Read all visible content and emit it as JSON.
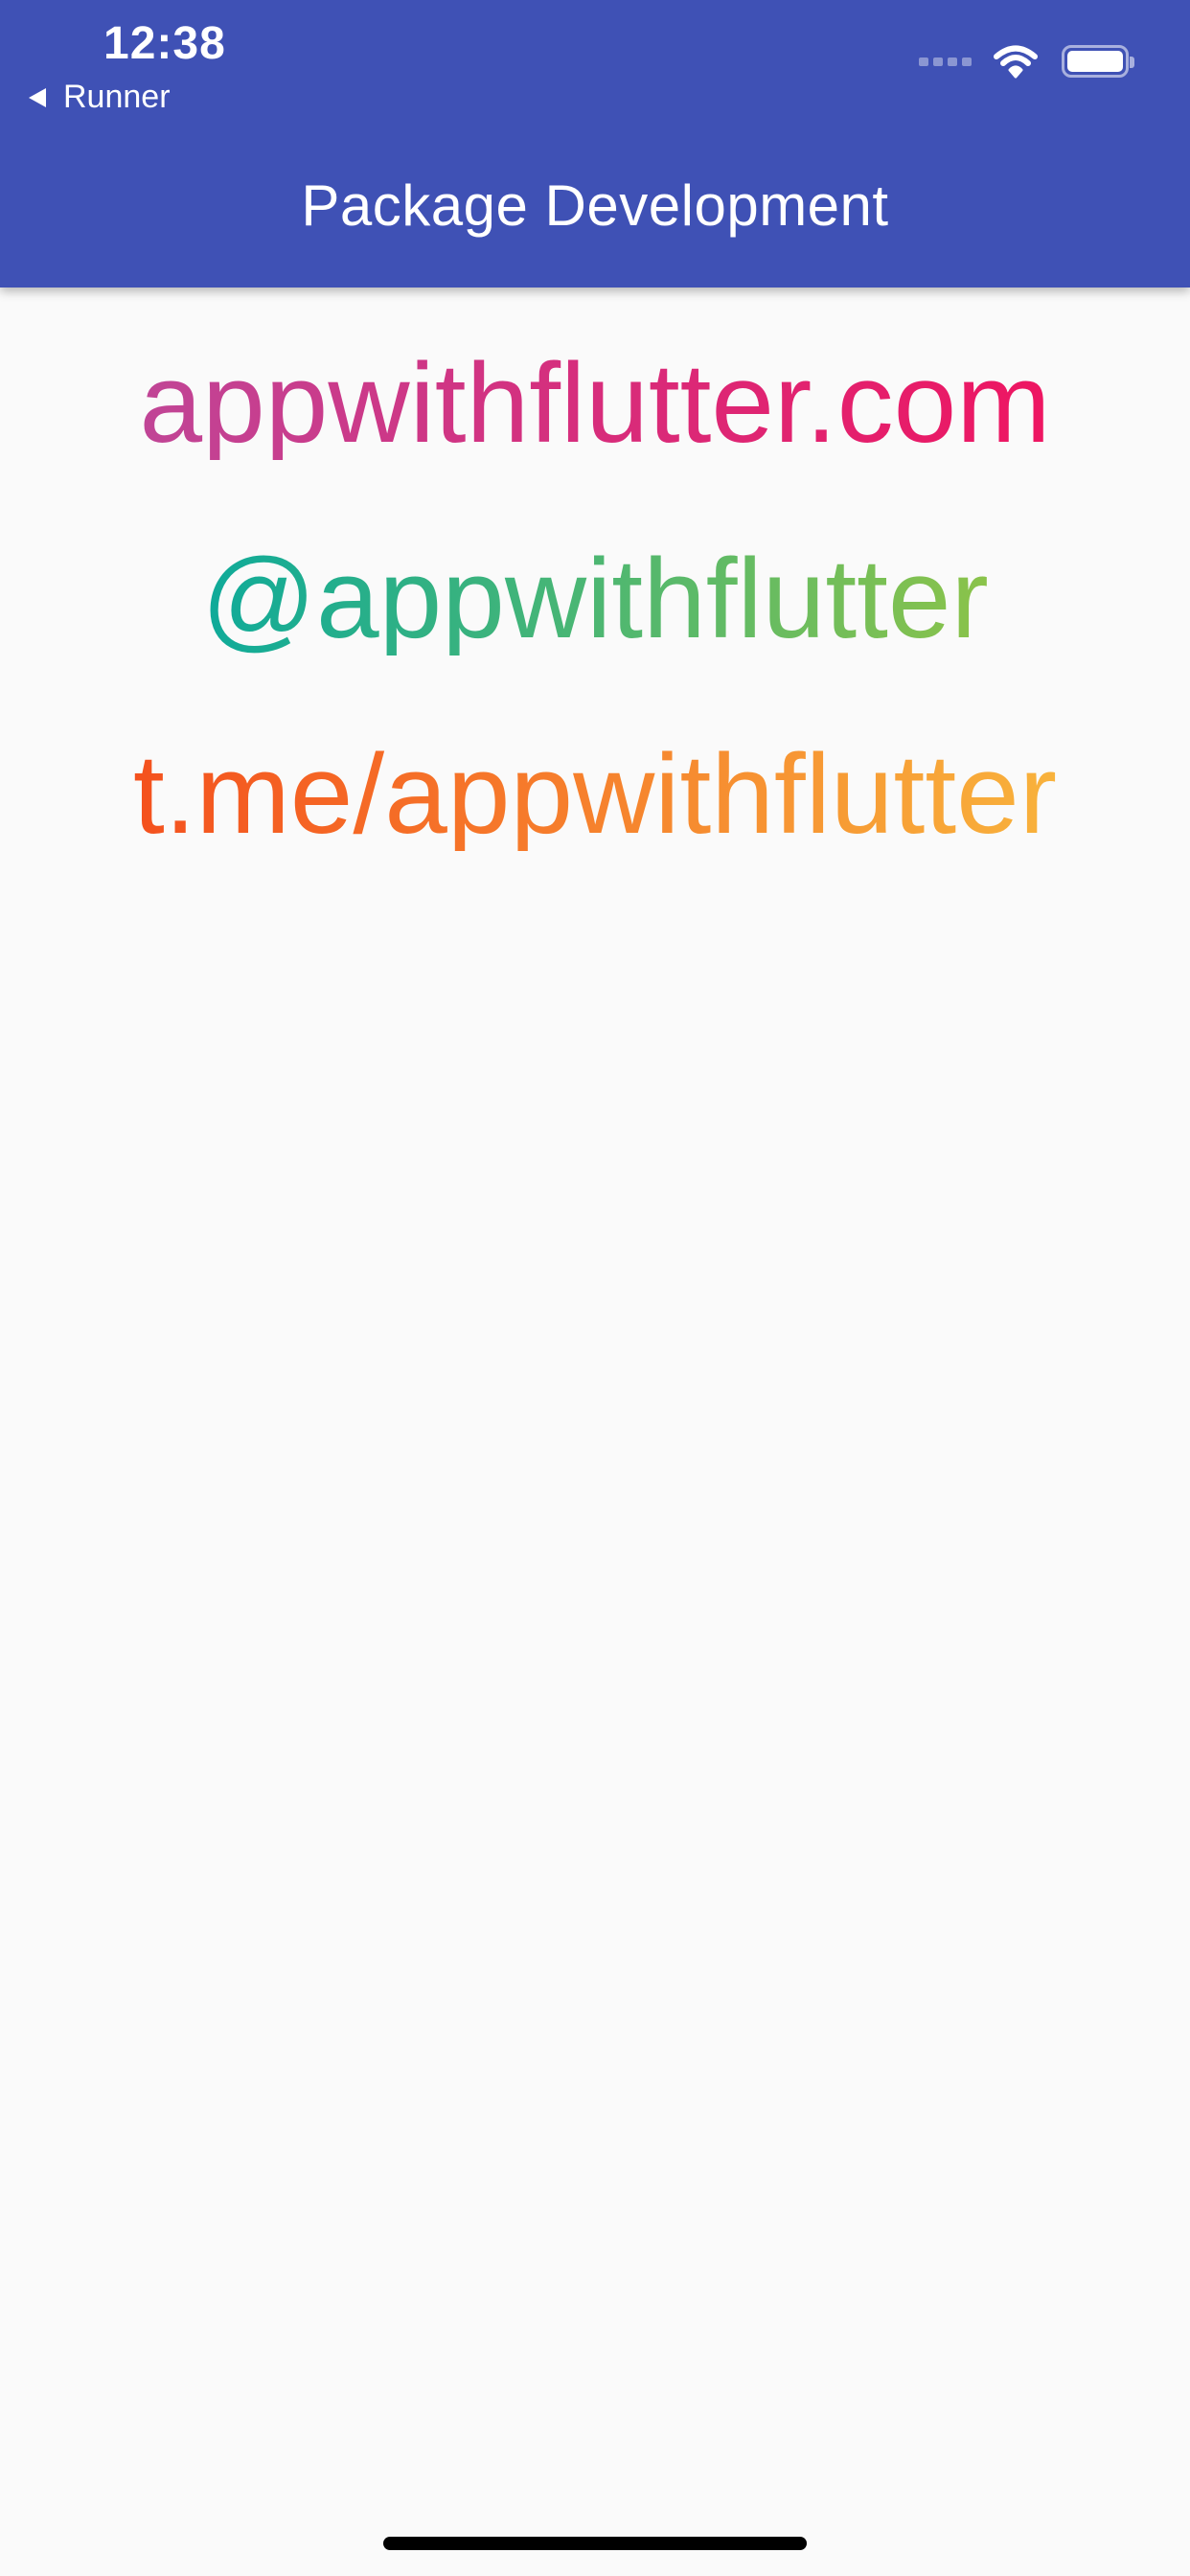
{
  "status_bar": {
    "time": "12:38",
    "back_app": "Runner",
    "icons": [
      "signal-icon",
      "wifi-icon",
      "battery-icon"
    ]
  },
  "app_bar": {
    "title": "Package Development",
    "color": "#3f51b5"
  },
  "links": [
    {
      "text": "appwithflutter.com",
      "gradient": [
        "#c04596",
        "#ee1561"
      ]
    },
    {
      "text": "@appwithflutter",
      "gradient": [
        "#0eaa9a",
        "#8bc34a"
      ]
    },
    {
      "text": "t.me/appwithflutter",
      "gradient": [
        "#f4511e",
        "#f8b23c"
      ]
    }
  ]
}
